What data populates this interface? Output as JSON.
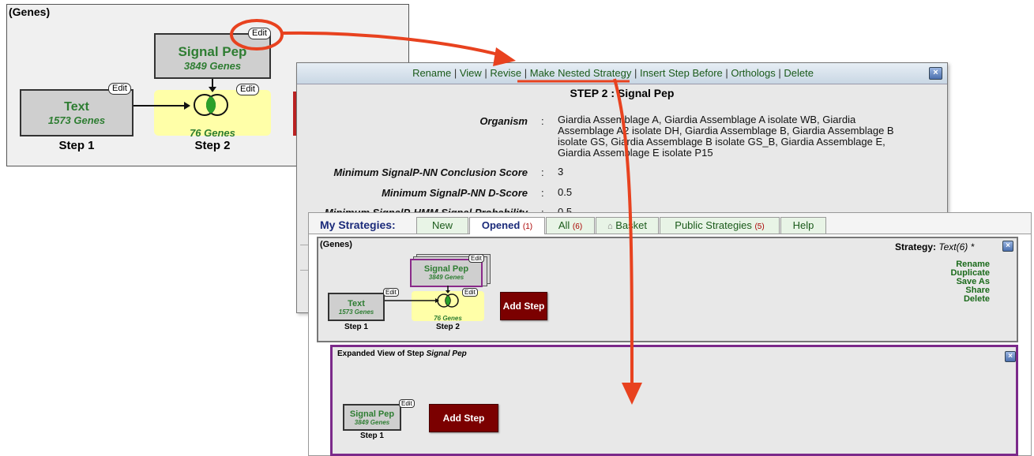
{
  "colors": {
    "accent_red": "#e8421f",
    "step_green": "#2e7d32",
    "nested_purple": "#7b2a8a",
    "add_step_bg": "#7b0000"
  },
  "panel1": {
    "record_type": "(Genes)",
    "edit_label": "Edit",
    "step1": {
      "name": "Text",
      "count": "1573 Genes",
      "label": "Step 1"
    },
    "step2": {
      "name": "Signal Pep",
      "count": "3849 Genes",
      "combined_count": "76 Genes",
      "label": "Step 2"
    }
  },
  "details": {
    "menu": [
      "Rename",
      "View",
      "Revise",
      "Make Nested Strategy",
      "Insert Step Before",
      "Orthologs",
      "Delete"
    ],
    "title": "STEP 2 : Signal Pep",
    "params": [
      {
        "label": "Organism",
        "value": "Giardia Assemblage A, Giardia Assemblage A isolate WB, Giardia Assemblage A2 isolate DH, Giardia Assemblage B, Giardia Assemblage B isolate GS, Giardia Assemblage B isolate GS_B, Giardia Assemblage E, Giardia Assemblage E isolate P15"
      },
      {
        "label": "Minimum SignalP-NN Conclusion Score",
        "value": "3"
      },
      {
        "label": "Minimum SignalP-NN D-Score",
        "value": "0.5"
      },
      {
        "label": "Minimum SignalP-HMM Signal Probability",
        "value": "0.5"
      }
    ],
    "colon": ":",
    "organism_lines": [
      "Giardia Assemblage A, Giardia Assemblage A isolate WB, Giardia",
      "Assemblage A2 isolate DH, Giardia Assemblage B, Giardia Assemblage B",
      "isolate GS, Giardia Assemblage B isolate GS_B, Giardia Assemblage E,",
      "Giardia Assemblage E isolate P15"
    ]
  },
  "strategies": {
    "title": "My Strategies:",
    "tabs": [
      {
        "label": "New",
        "count": ""
      },
      {
        "label": "Opened",
        "count": "(1)"
      },
      {
        "label": "All",
        "count": "(6)"
      },
      {
        "label": "Basket",
        "count": ""
      },
      {
        "label": "Public Strategies",
        "count": "(5)"
      },
      {
        "label": "Help",
        "count": ""
      }
    ],
    "record_type": "(Genes)",
    "strategy_label": "Strategy:",
    "strategy_name": "Text(6) *",
    "actions": [
      "Rename",
      "Duplicate",
      "Save As",
      "Share",
      "Delete"
    ],
    "add_step": "Add Step",
    "edit_label": "Edit",
    "step1": {
      "name": "Text",
      "count": "1573 Genes",
      "label": "Step 1"
    },
    "step2": {
      "name": "Signal Pep",
      "count": "3849 Genes",
      "combined_count": "76 Genes",
      "label": "Step 2"
    },
    "expanded": {
      "title_prefix": "Expanded View of Step",
      "title_name": "Signal Pep",
      "step": {
        "name": "Signal Pep",
        "count": "3849 Genes",
        "label": "Step 1"
      },
      "add_step": "Add Step"
    },
    "close_glyph": "×"
  }
}
